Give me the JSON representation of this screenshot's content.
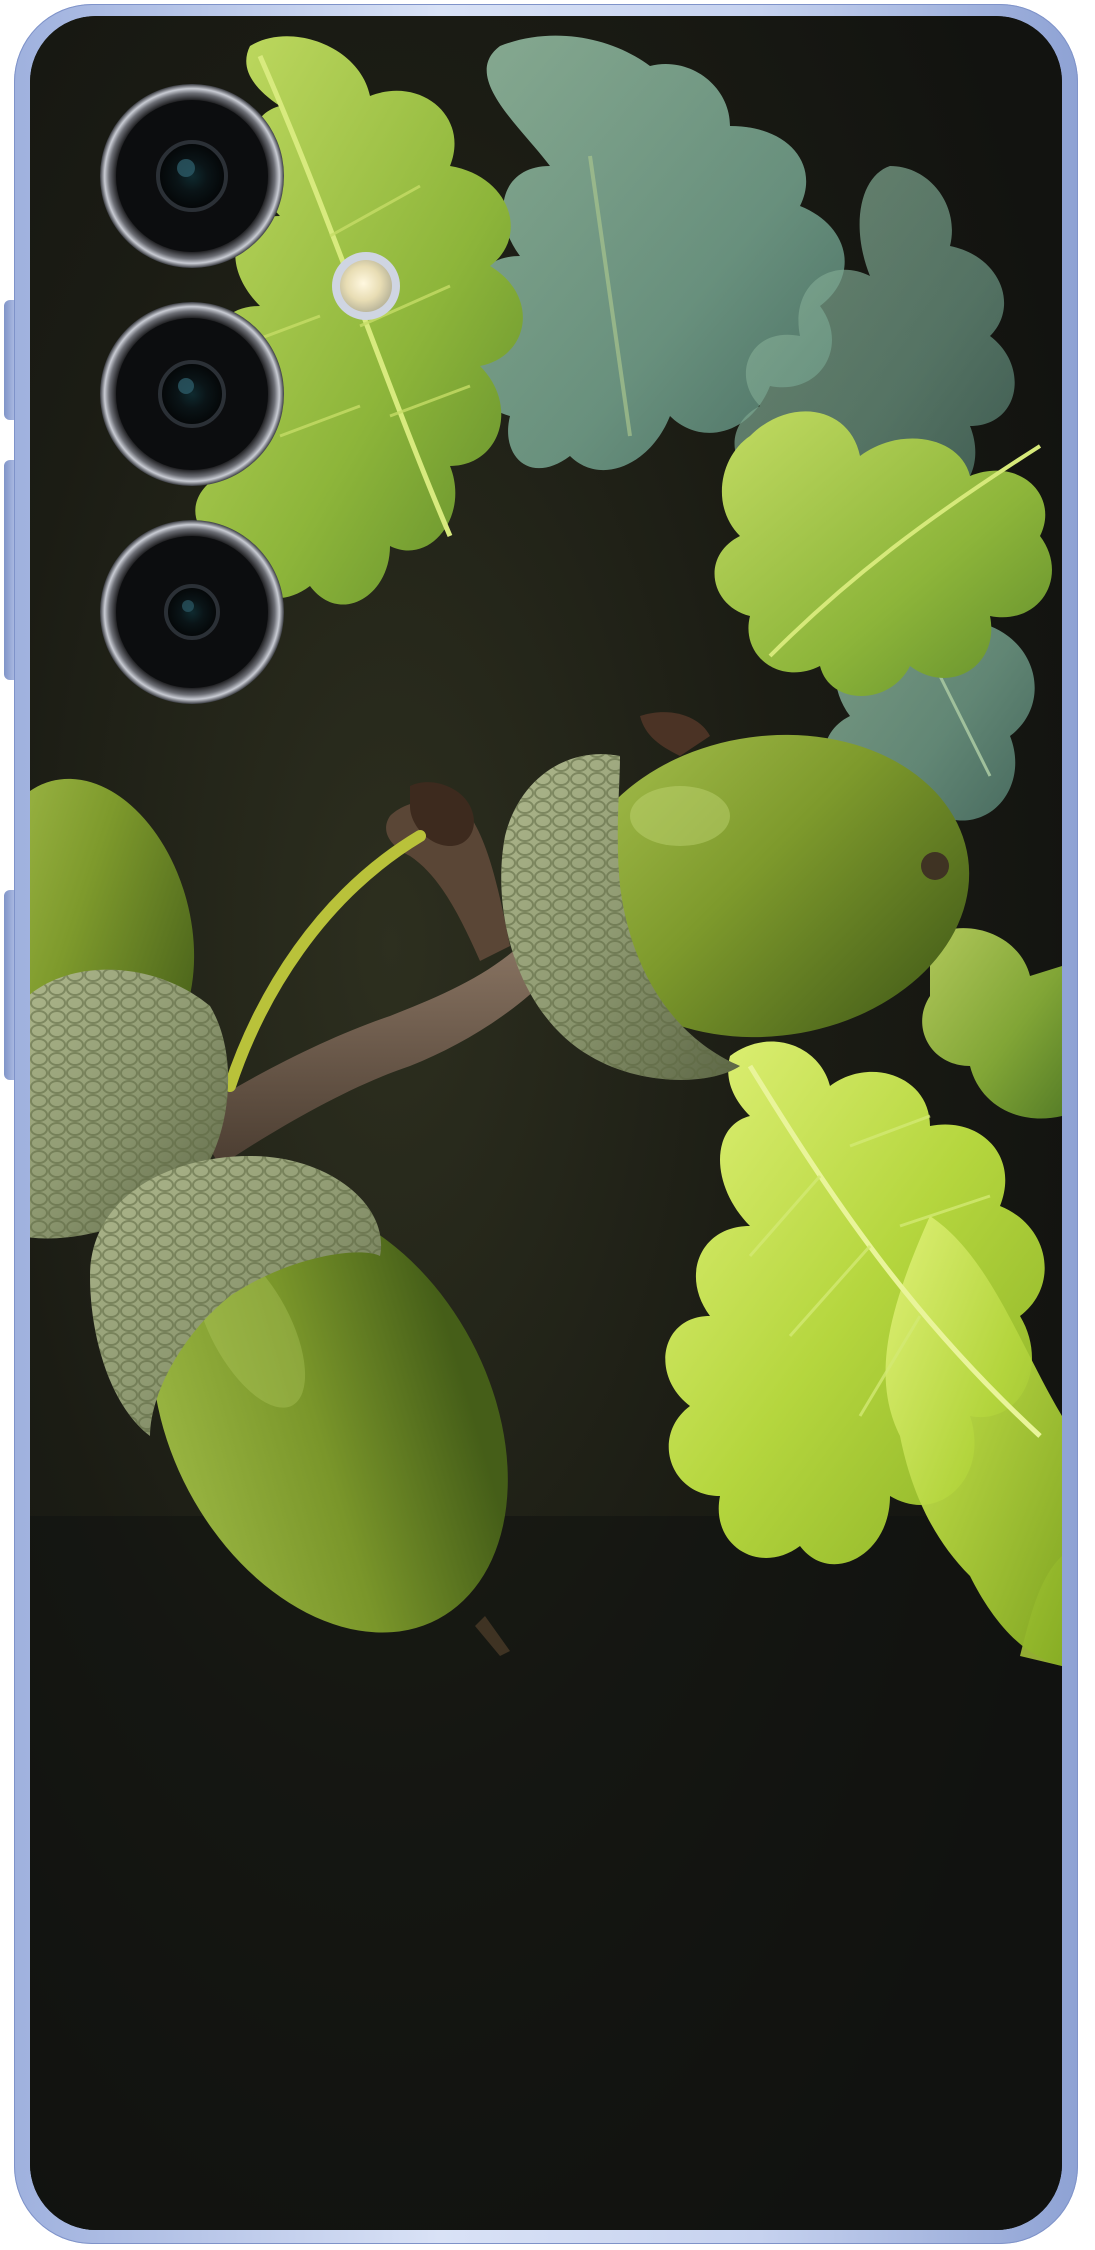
{
  "scene": {
    "kind": "phone-back-photo",
    "camera_lens_count": 3,
    "has_flash": true
  },
  "colors": {
    "frame": "#c6d2ef",
    "background": "#161711",
    "acorn": "#7e9a2c",
    "acorn_cup": "#8f9a72",
    "leaf_bright": "#c7e64e",
    "leaf_blue": "#6f9a86",
    "branch": "#6a5847"
  }
}
